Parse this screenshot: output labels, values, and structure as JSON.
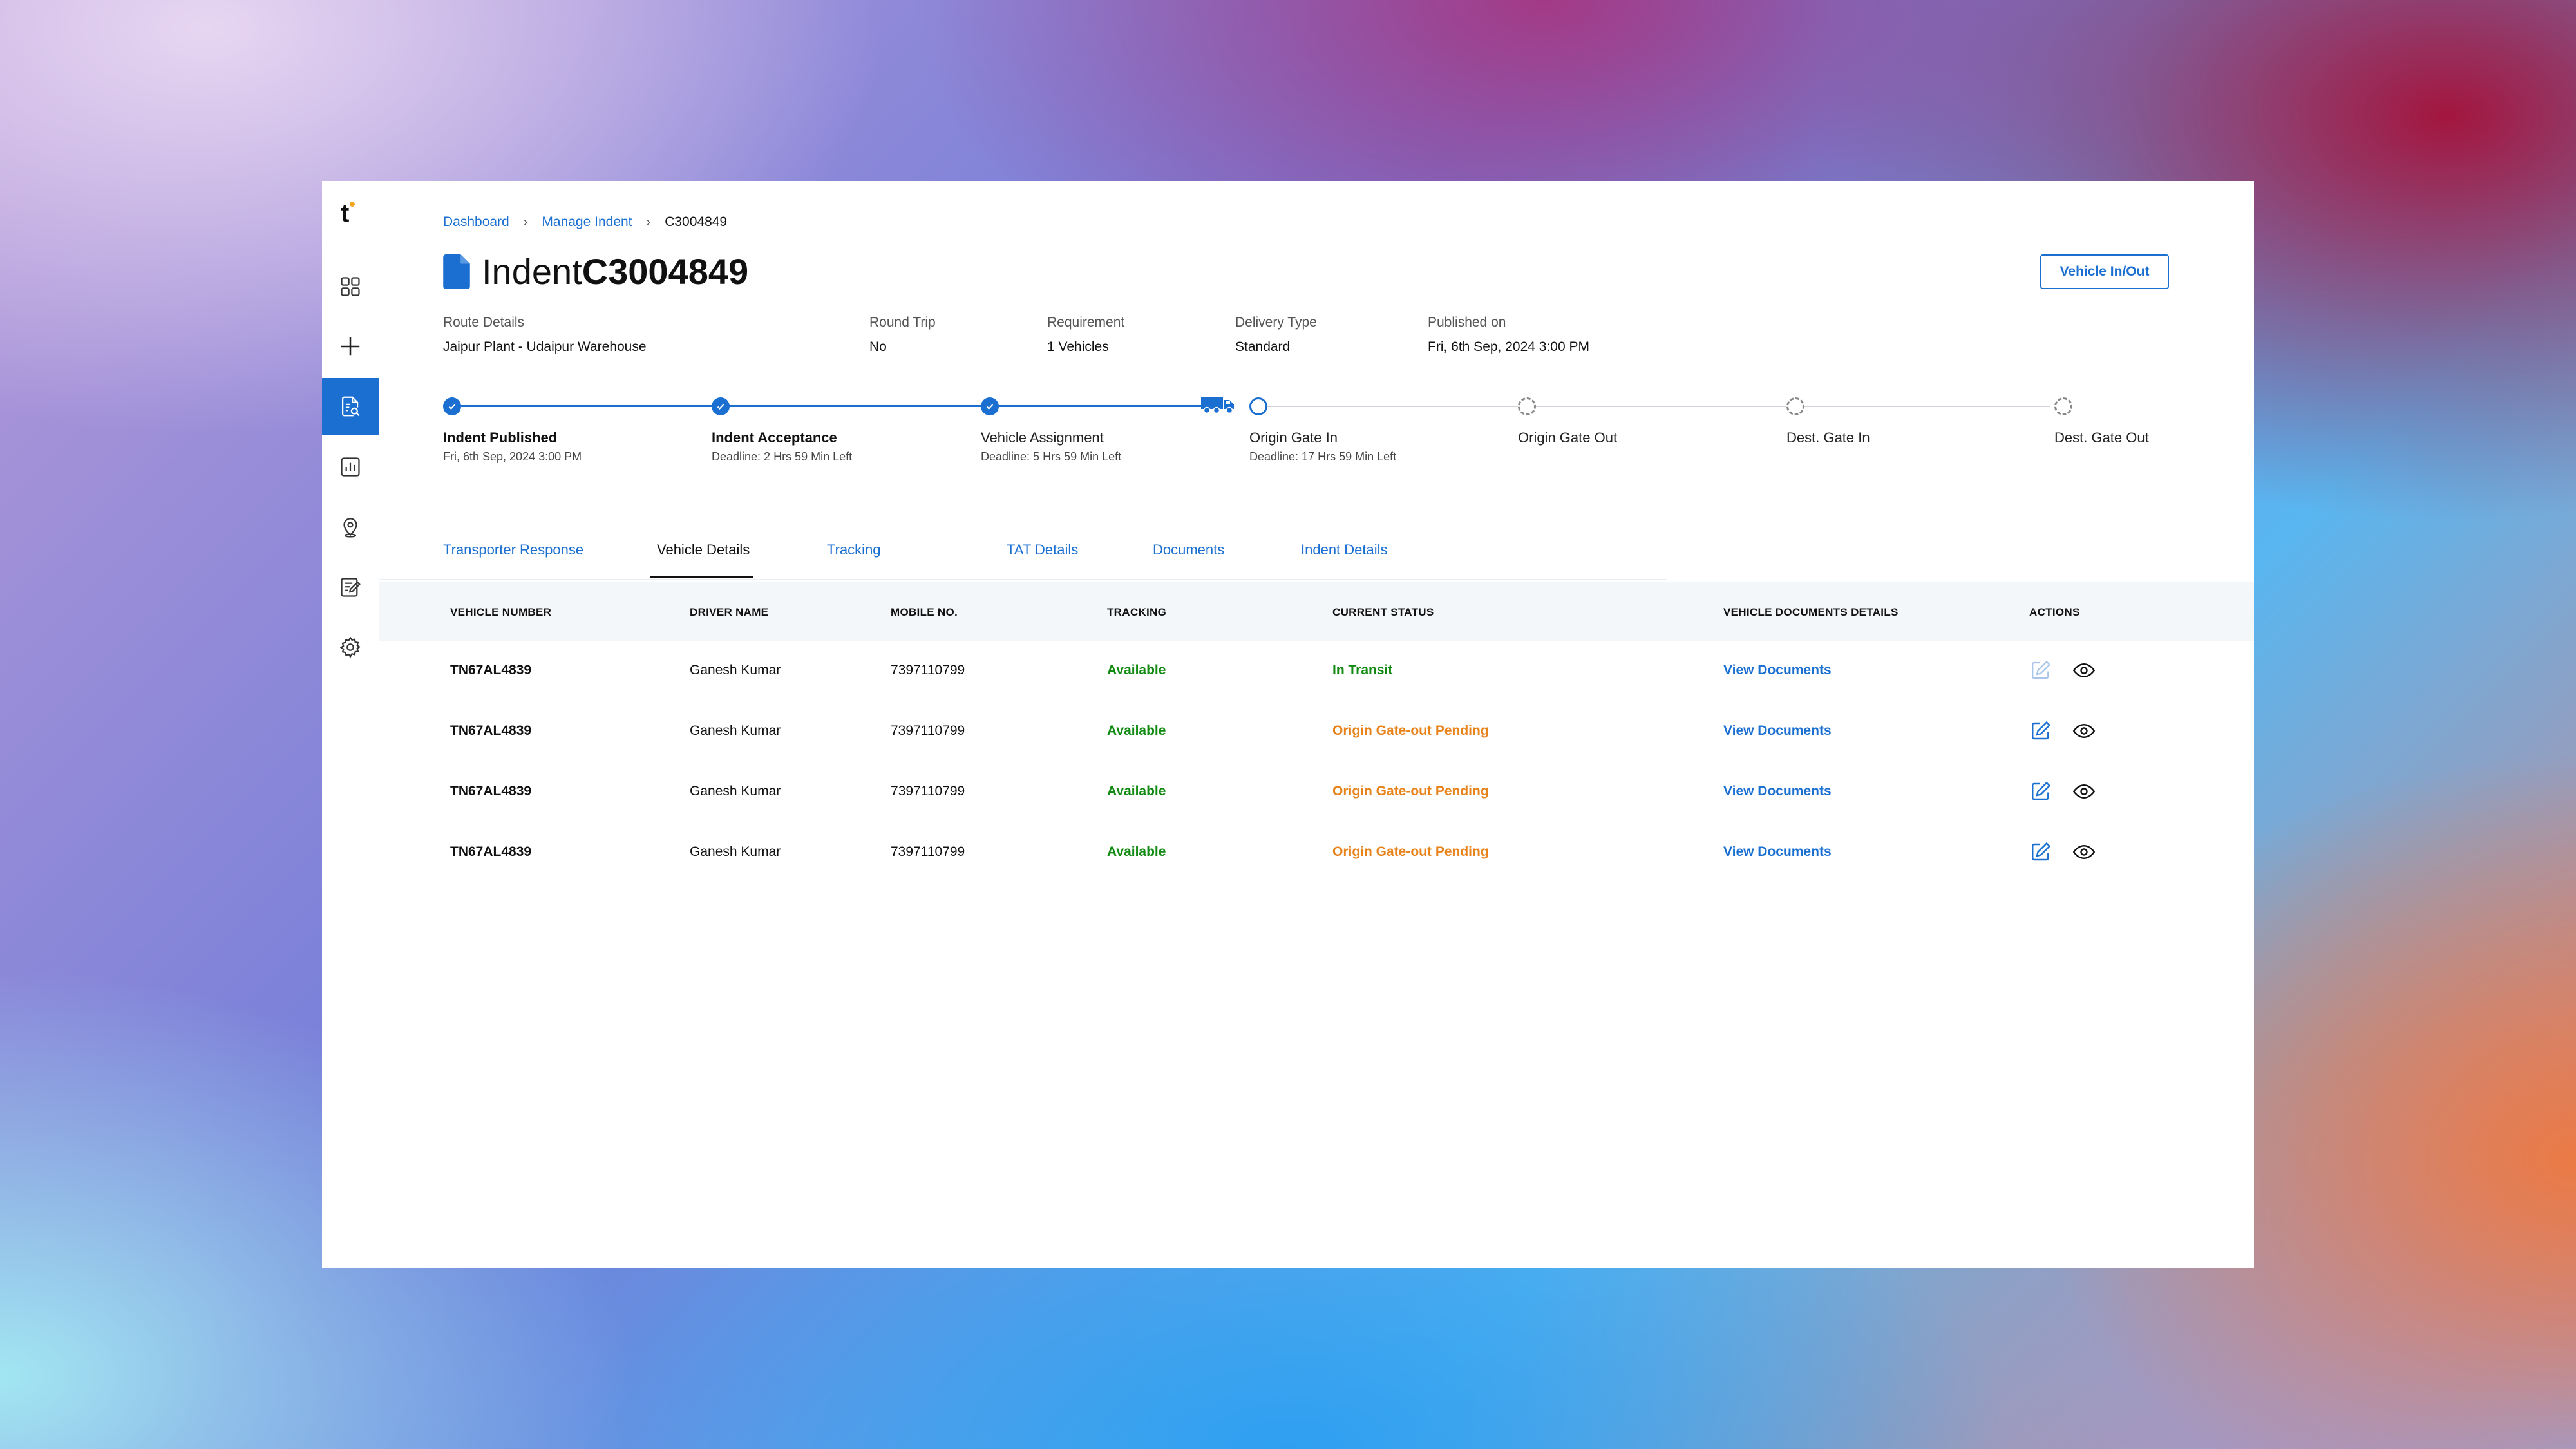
{
  "sidebar": {
    "logo": "t",
    "items": [
      {
        "icon": "dashboard-grid-icon"
      },
      {
        "icon": "plus-icon"
      },
      {
        "icon": "document-search-icon",
        "active": true
      },
      {
        "icon": "bar-chart-icon"
      },
      {
        "icon": "location-pin-icon"
      },
      {
        "icon": "edit-list-icon"
      },
      {
        "icon": "gear-icon"
      }
    ]
  },
  "breadcrumb": {
    "items": [
      "Dashboard",
      "Manage Indent"
    ],
    "current": "C3004849"
  },
  "title": {
    "prefix": "Indent",
    "id": "C3004849"
  },
  "header_button": "Vehicle In/Out",
  "meta": [
    {
      "label": "Route Details",
      "value": "Jaipur Plant - Udaipur Warehouse"
    },
    {
      "label": "Round Trip",
      "value": "No"
    },
    {
      "label": "Requirement",
      "value": "1 Vehicles"
    },
    {
      "label": "Delivery Type",
      "value": "Standard"
    },
    {
      "label": "Published on",
      "value": "Fri, 6th Sep, 2024 3:00 PM"
    }
  ],
  "steps": [
    {
      "title": "Indent Published",
      "sub": "Fri, 6th Sep, 2024 3:00 PM",
      "status": "done"
    },
    {
      "title": "Indent Acceptance",
      "sub": "Deadline: 2 Hrs 59 Min Left",
      "status": "done"
    },
    {
      "title": "Vehicle Assignment",
      "sub": "Deadline: 5 Hrs 59 Min Left",
      "status": "done"
    },
    {
      "title": "Origin Gate In",
      "sub": "Deadline: 17 Hrs 59 Min Left",
      "status": "current"
    },
    {
      "title": "Origin Gate Out",
      "sub": "",
      "status": "pending"
    },
    {
      "title": "Dest. Gate In",
      "sub": "",
      "status": "pending"
    },
    {
      "title": "Dest. Gate Out",
      "sub": "",
      "status": "pending"
    }
  ],
  "tabs": [
    {
      "label": "Transporter Response",
      "active": false
    },
    {
      "label": "Vehicle Details",
      "active": true
    },
    {
      "label": "Tracking",
      "active": false
    },
    {
      "label": "TAT Details",
      "active": false
    },
    {
      "label": "Documents",
      "active": false
    },
    {
      "label": "Indent Details",
      "active": false
    }
  ],
  "table": {
    "columns": [
      "VEHICLE NUMBER",
      "DRIVER NAME",
      "MOBILE NO.",
      "TRACKING",
      "CURRENT STATUS",
      "VEHICLE DOCUMENTS DETAILS",
      "ACTIONS"
    ],
    "rows": [
      {
        "vehicle": "TN67AL4839",
        "driver": "Ganesh Kumar",
        "mobile": "7397110799",
        "tracking": "Available",
        "status": "In Transit",
        "status_color": "#108a10",
        "docs": "View Documents",
        "edit_enabled": false
      },
      {
        "vehicle": "TN67AL4839",
        "driver": "Ganesh Kumar",
        "mobile": "7397110799",
        "tracking": "Available",
        "status": "Origin Gate-out Pending",
        "status_color": "#e8821a",
        "docs": "View Documents",
        "edit_enabled": true
      },
      {
        "vehicle": "TN67AL4839",
        "driver": "Ganesh Kumar",
        "mobile": "7397110799",
        "tracking": "Available",
        "status": "Origin Gate-out Pending",
        "status_color": "#e8821a",
        "docs": "View Documents",
        "edit_enabled": true
      },
      {
        "vehicle": "TN67AL4839",
        "driver": "Ganesh Kumar",
        "mobile": "7397110799",
        "tracking": "Available",
        "status": "Origin Gate-out Pending",
        "status_color": "#e8821a",
        "docs": "View Documents",
        "edit_enabled": true
      }
    ]
  },
  "colors": {
    "accent": "#1a6fd1",
    "success": "#108a10",
    "warning": "#e8821a"
  }
}
